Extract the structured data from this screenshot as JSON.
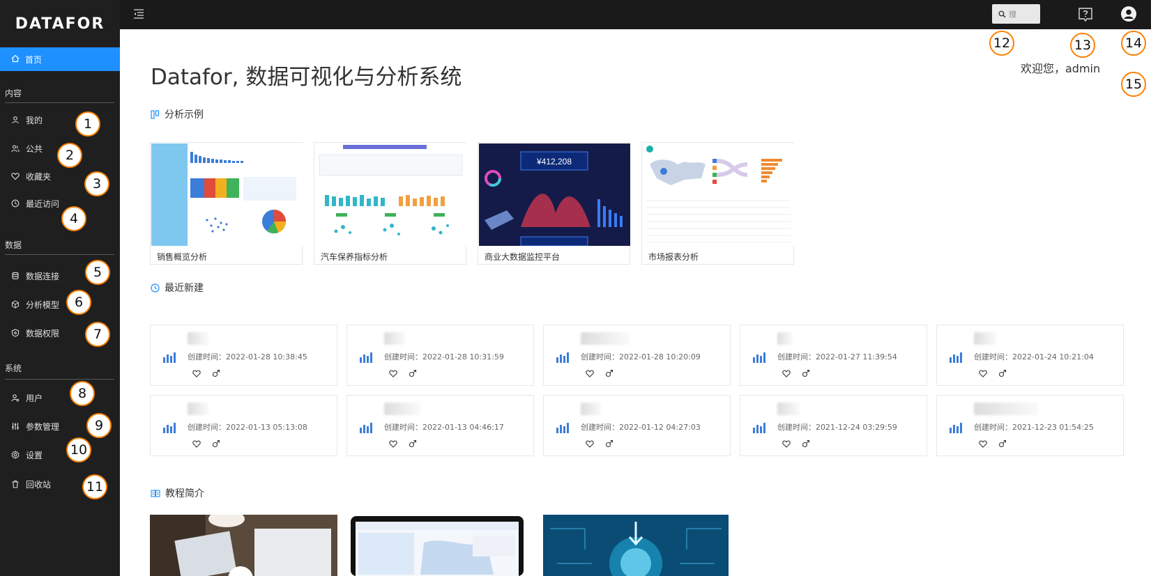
{
  "sidebar": {
    "logo": "DATAFOR",
    "home": "首页",
    "sections": [
      {
        "title": "内容",
        "items": [
          {
            "label": "我的",
            "icon": "user-icon"
          },
          {
            "label": "公共",
            "icon": "users-icon"
          },
          {
            "label": "收藏夹",
            "icon": "heart-icon"
          },
          {
            "label": "最近访问",
            "icon": "clock-icon"
          }
        ]
      },
      {
        "title": "数据",
        "items": [
          {
            "label": "数据连接",
            "icon": "database-icon"
          },
          {
            "label": "分析模型",
            "icon": "cube-icon"
          },
          {
            "label": "数据权限",
            "icon": "shield-icon"
          }
        ]
      },
      {
        "title": "系统",
        "items": [
          {
            "label": "用户",
            "icon": "user-gear-icon"
          },
          {
            "label": "参数管理",
            "icon": "sliders-icon"
          },
          {
            "label": "设置",
            "icon": "gear-icon"
          },
          {
            "label": "回收站",
            "icon": "trash-icon"
          }
        ]
      }
    ]
  },
  "topbar": {
    "search_placeholder": "搜"
  },
  "main": {
    "title": "Datafor, 数据可视化与分析系统",
    "welcome": "欢迎您，admin",
    "examples_title": "分析示例",
    "examples": [
      {
        "label": "销售概览分析"
      },
      {
        "label": "汽车保养指标分析"
      },
      {
        "label": "商业大数据监控平台",
        "value": "¥412,208"
      },
      {
        "label": "市场报表分析"
      }
    ],
    "recent_title": "最近新建",
    "recent": [
      {
        "time": "创建时间：2022-01-28 10:38:45"
      },
      {
        "time": "创建时间：2022-01-28 10:31:59"
      },
      {
        "time": "创建时间：2022-01-28 10:20:09"
      },
      {
        "time": "创建时间：2022-01-27 11:39:54"
      },
      {
        "time": "创建时间：2022-01-24 10:21:04"
      },
      {
        "time": "创建时间：2022-01-13 05:13:08"
      },
      {
        "time": "创建时间：2022-01-13 04:46:17"
      },
      {
        "time": "创建时间：2022-01-12 04:27:03"
      },
      {
        "time": "创建时间：2021-12-24 03:29:59"
      },
      {
        "time": "创建时间：2021-12-23 01:54:25"
      }
    ],
    "tutorial_title": "教程简介"
  },
  "annotations": [
    "1",
    "2",
    "3",
    "4",
    "5",
    "6",
    "7",
    "8",
    "9",
    "10",
    "11",
    "12",
    "13",
    "14",
    "15"
  ],
  "colors": {
    "sidebar_bg": "#1f1f1f",
    "accent": "#1e90ff",
    "badge_border": "#ff7f00",
    "topbar_bg": "#1a1a1a"
  }
}
